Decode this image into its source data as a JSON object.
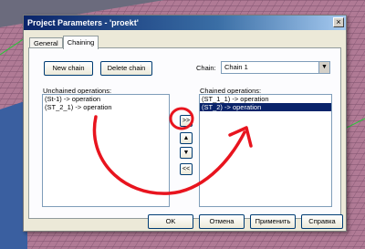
{
  "window": {
    "title": "Project Parameters - 'proekt'",
    "close_symbol": "×"
  },
  "tabs": [
    {
      "label": "General",
      "active": false
    },
    {
      "label": "Chaining",
      "active": true
    }
  ],
  "toolbar": {
    "new_chain": "New chain",
    "delete_chain": "Delete chain"
  },
  "chain": {
    "label": "Chain:",
    "selected": "Chain 1",
    "dropdown_icon": "chevron-down-icon"
  },
  "unchained": {
    "label": "Unchained operations:",
    "items": [
      "(St-1) -> operation",
      "(ST_2_1) -> operation"
    ]
  },
  "chained": {
    "label": "Chained operations:",
    "items": [
      "(ST_1_1) -> operation",
      "(ST_2) -> operation"
    ],
    "selected_index": 1
  },
  "move_buttons": {
    "add": ">>",
    "up": "▲",
    "down": "▼",
    "remove": "<<"
  },
  "footer": {
    "ok": "OK",
    "cancel": "Отмена",
    "apply": "Применить",
    "help": "Справка"
  },
  "colors": {
    "selection": "#0a246a",
    "annotation": "#e8141e",
    "titlebar": "#0a246a"
  }
}
